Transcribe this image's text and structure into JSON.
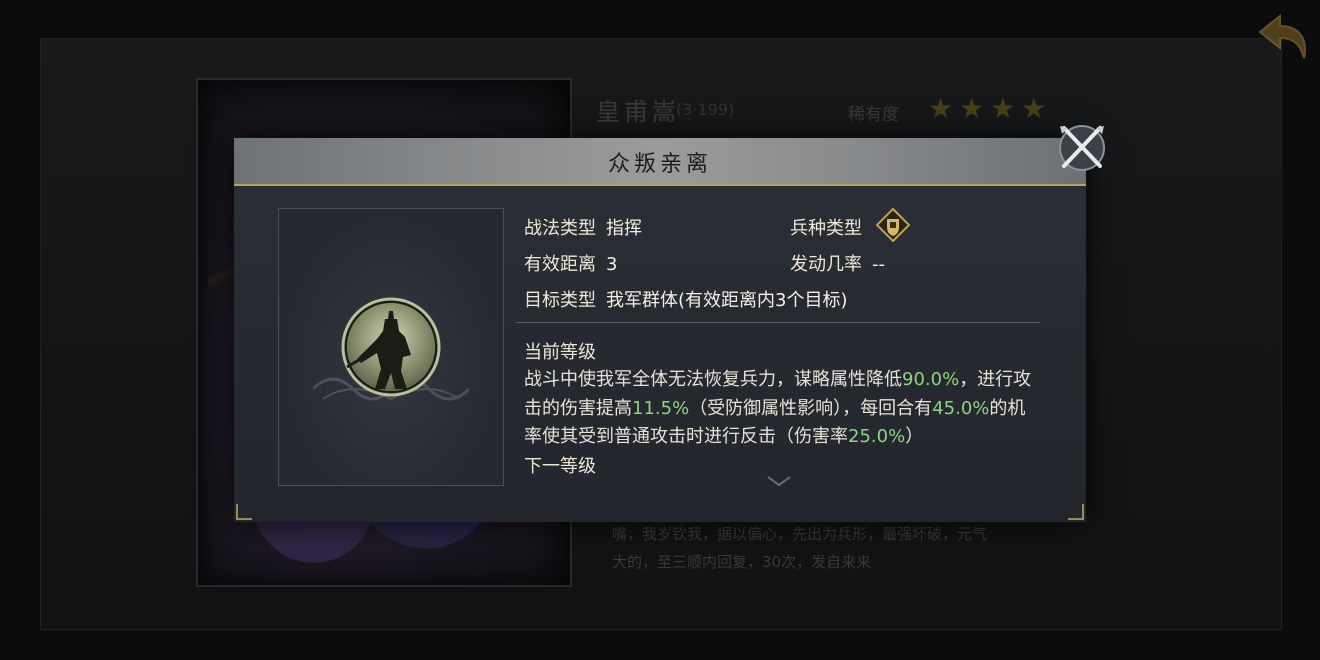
{
  "background": {
    "hero_name": "皇甫嵩",
    "hero_sub": "(3·199)",
    "rarity_label": "稀有度",
    "stars": "★★★★",
    "desc_lines": [
      "嘴，我岁钦我，据以偏心，先出为兵形，最强坏破，元气",
      "大的，至三顺内回复，30次，发自来来"
    ]
  },
  "modal": {
    "title": "众叛亲离",
    "fields": {
      "tactic_type_label": "战法类型",
      "tactic_type_value": "指挥",
      "troop_type_label": "兵种类型",
      "range_label": "有效距离",
      "range_value": "3",
      "trigger_rate_label": "发动几率",
      "trigger_rate_value": "--",
      "target_label": "目标类型",
      "target_value": "我军群体(有效距离内3个目标)"
    },
    "current_level_title": "当前等级",
    "description": {
      "t1": "战斗中使我军全体无法恢复兵力，谋略属性降低",
      "v1": "90.0%",
      "t2": "，进行攻击的伤害提高",
      "v2": "11.5%",
      "t3": "（受防御属性影响），每回合有",
      "v3": "45.0%",
      "t4": "的机率使其受到普通攻击时进行反击（伤害率",
      "v4": "25.0%",
      "t5": "）"
    },
    "next_level_title": "下一等级"
  },
  "colors": {
    "highlight": "#8fd47e",
    "gold_accent": "#b8a062",
    "header_bg": "#8a8c8e"
  },
  "icons": {
    "close": "crossed-swords-icon",
    "troop": "shield-fist-icon",
    "back": "back-arrow-icon",
    "scroll": "chevron-down-icon"
  }
}
